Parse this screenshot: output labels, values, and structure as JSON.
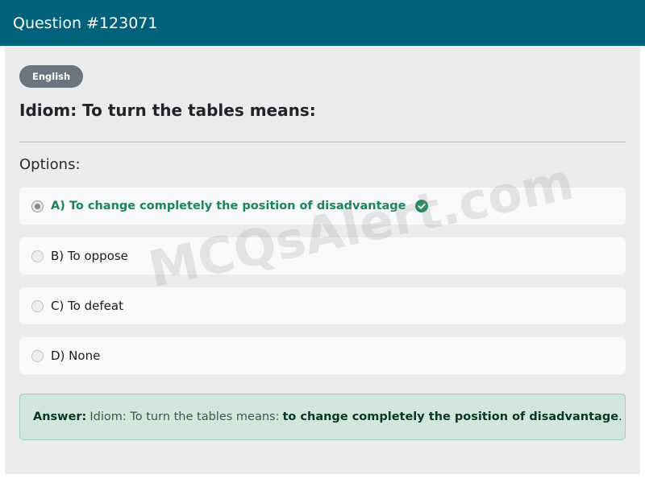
{
  "header": {
    "title": "Question #123071"
  },
  "badge": {
    "label": "English"
  },
  "question": {
    "text": "Idiom: To turn the tables means:"
  },
  "options_label": "Options:",
  "options": [
    {
      "label": "A) To change completely the position of disadvantage",
      "selected": true,
      "correct": true
    },
    {
      "label": "B) To oppose",
      "selected": false,
      "correct": false
    },
    {
      "label": "C) To defeat",
      "selected": false,
      "correct": false
    },
    {
      "label": "D) None",
      "selected": false,
      "correct": false
    }
  ],
  "answer": {
    "label": "Answer:",
    "question_text": "Idiom: To turn the tables means:",
    "answer_text": "to change completely the position of disadvantage",
    "suffix": "."
  },
  "watermark": {
    "text": "MCQsAlert.com"
  },
  "colors": {
    "header_bg": "#00627a",
    "correct": "#198754",
    "answer_bg": "#d1e7dd",
    "badge_bg": "#6c757d"
  },
  "icons": {
    "correct_marker": "check-circle-icon"
  }
}
